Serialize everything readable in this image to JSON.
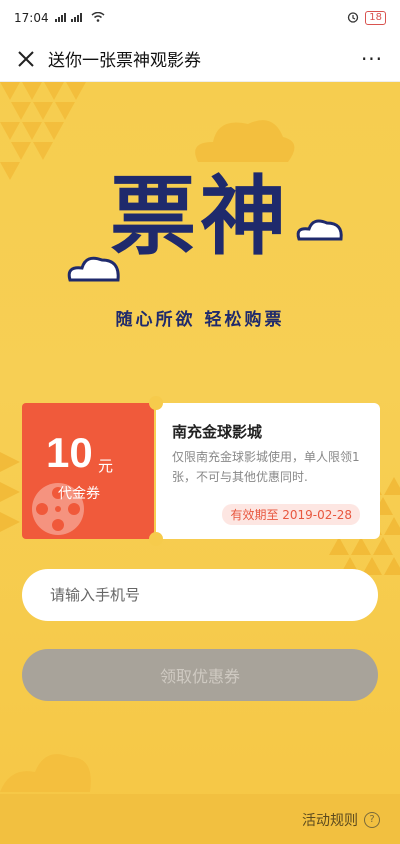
{
  "status": {
    "time": "17:04",
    "signal": "4G 4G",
    "battery": "18"
  },
  "header": {
    "title": "送你一张票神观影券",
    "more": "···"
  },
  "logo": {
    "title": "票神",
    "slogan": "随心所欲 轻松购票"
  },
  "coupon": {
    "amount": "10",
    "unit": "元",
    "type": "代金券",
    "cinema": "南充金球影城",
    "desc": "仅限南充金球影城使用，单人限领1张，不可与其他优惠同时.",
    "valid": "有效期至 2019-02-28"
  },
  "form": {
    "phone_placeholder": "请输入手机号",
    "submit_label": "领取优惠券"
  },
  "footer": {
    "rules_label": "活动规则",
    "help": "?"
  },
  "colors": {
    "background": "#f6cd4f",
    "coupon_red": "#f05a3b",
    "logo_blue": "#1f2a6c",
    "button_gray": "#a8a39a"
  }
}
